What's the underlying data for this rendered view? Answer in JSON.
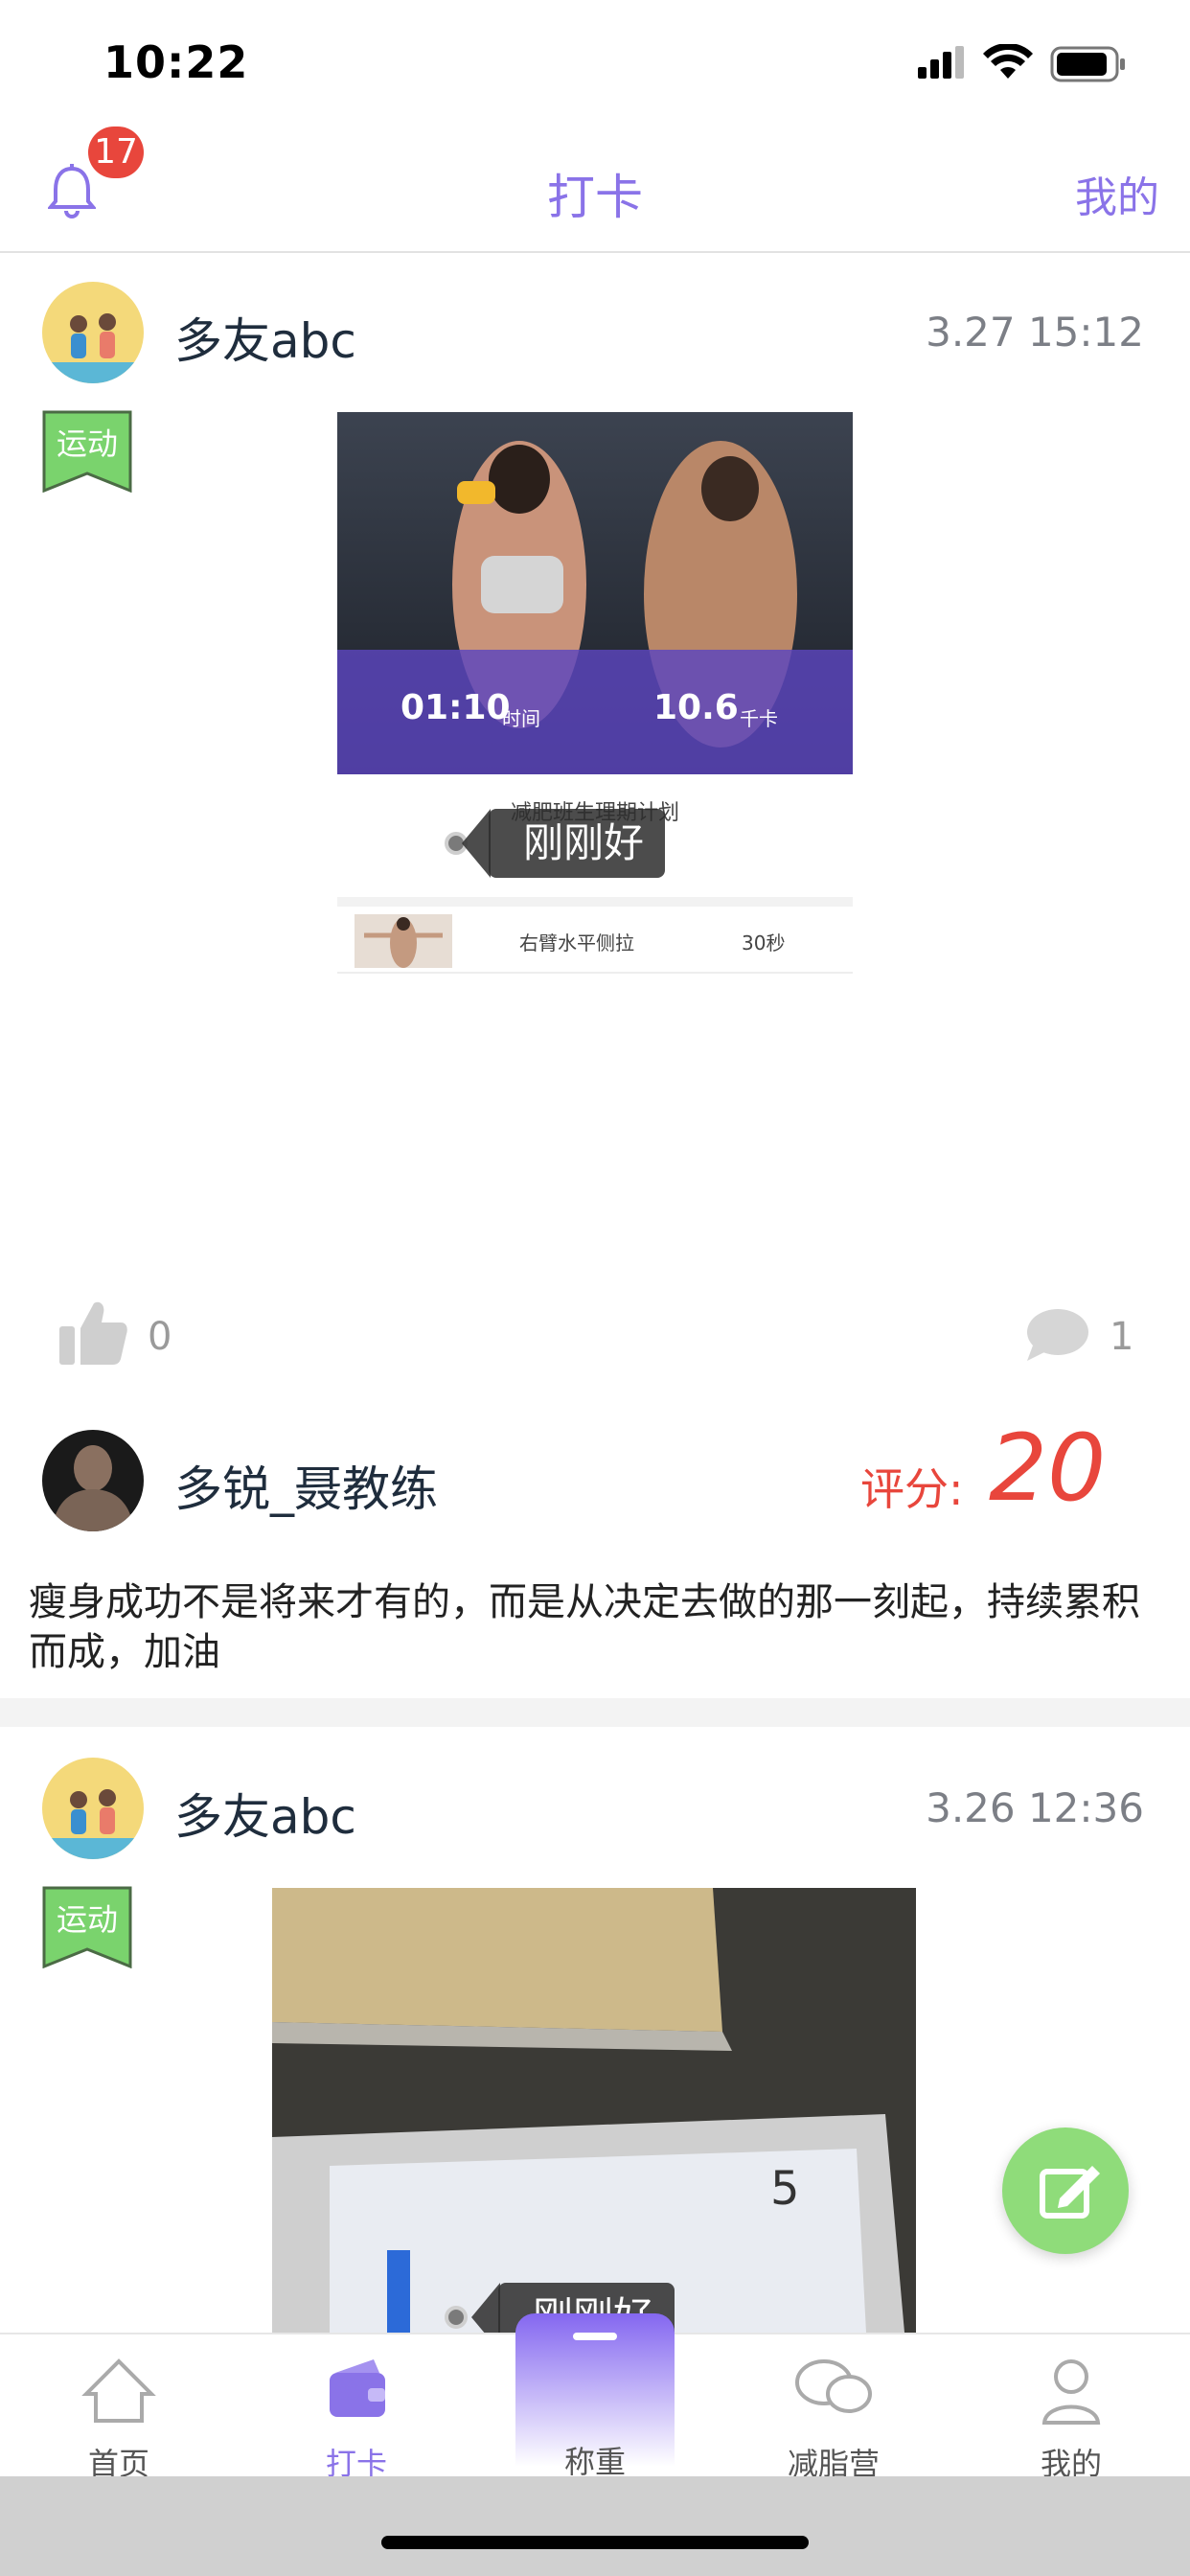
{
  "status_bar": {
    "time": "10:22"
  },
  "header": {
    "title": "打卡",
    "right_link": "我的",
    "notification_count": "17"
  },
  "posts": [
    {
      "user": "多友abc",
      "time": "3.27 15:12",
      "tag": "运动",
      "image_overlay": {
        "time_value": "01:10",
        "time_unit": "时间",
        "kcal_value": "10.6",
        "kcal_unit": "千卡",
        "plan_title": "减肥班生理期计划",
        "exercise_name": "右臂水平侧拉",
        "exercise_duration": "30秒"
      },
      "sticker_label": "刚刚好",
      "likes": "0",
      "comments": "1",
      "coach": {
        "name": "多锐_聂教练",
        "score_label": "评分:",
        "score_value": "20",
        "comment": "瘦身成功不是将来才有的，而是从决定去做的那一刻起，持续累积而成，加油"
      }
    },
    {
      "user": "多友abc",
      "time": "3.26 12:36",
      "tag": "运动",
      "sticker_label": "刚刚好"
    }
  ],
  "tabbar": {
    "items": [
      {
        "label": "首页"
      },
      {
        "label": "打卡"
      },
      {
        "label": "称重"
      },
      {
        "label": "减脂营"
      },
      {
        "label": "我的"
      }
    ],
    "active_color": "#8a73e8"
  },
  "colors": {
    "accent": "#8a73e8",
    "tag_green": "#7ad36d",
    "score_red": "#e8463c",
    "fab_green": "#8fdc7a"
  }
}
